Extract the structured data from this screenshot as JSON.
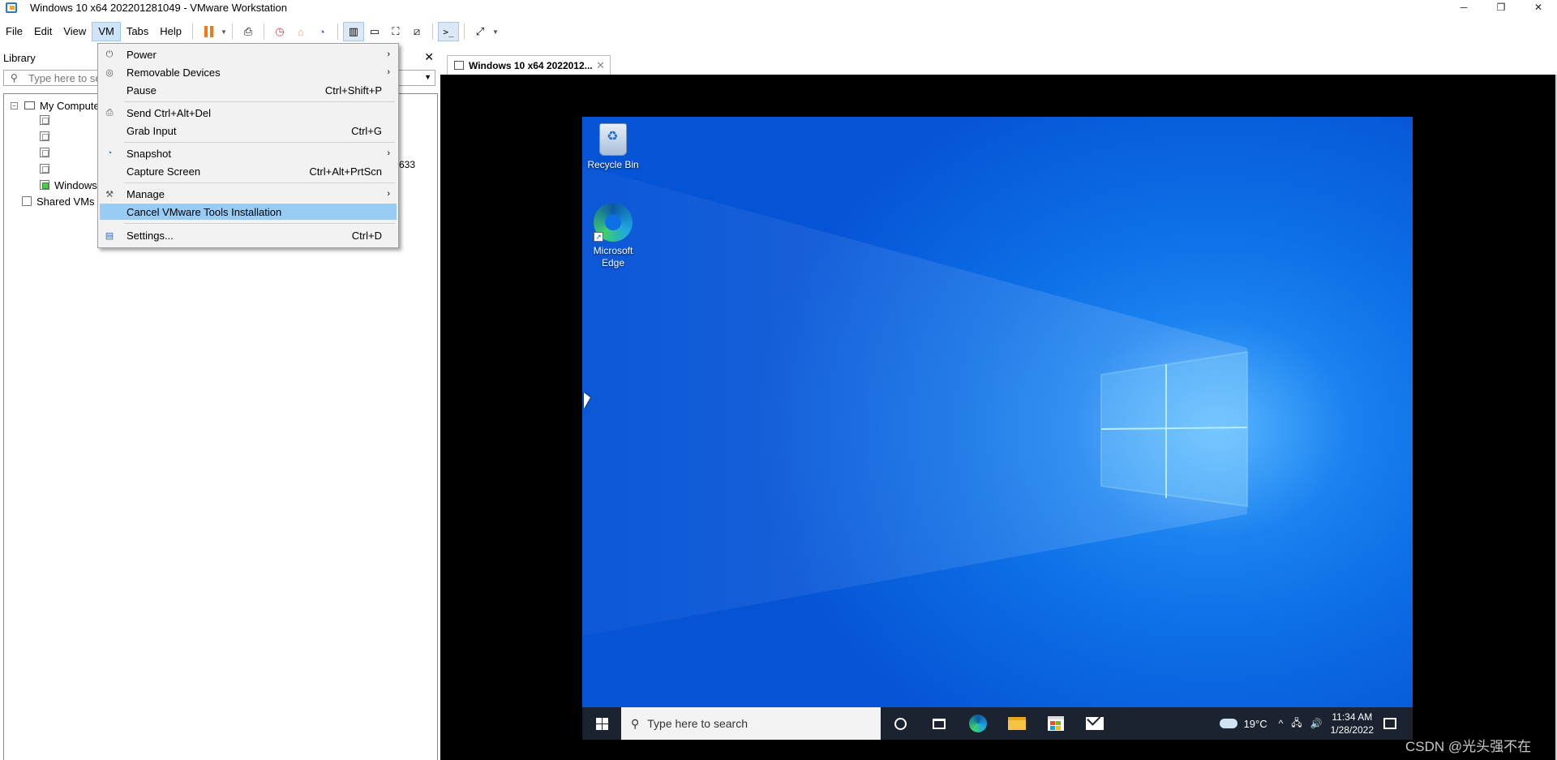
{
  "window": {
    "title": "Windows 10 x64 202201281049 - VMware Workstation",
    "minimize": "─",
    "restore": "❐",
    "close": "✕"
  },
  "menubar": {
    "items": [
      "File",
      "Edit",
      "View",
      "VM",
      "Tabs",
      "Help"
    ],
    "active": "VM"
  },
  "library": {
    "title": "Library",
    "close": "✕",
    "search_placeholder": "Type here to search",
    "tree": {
      "root_label": "My Computer",
      "root_toggle": "−",
      "running_vm_label": "Windows 10 x64 202201281049",
      "shared_label": "Shared VMs"
    },
    "stray_text": "633"
  },
  "vm_menu": {
    "items": [
      {
        "label": "Power",
        "shortcut": "",
        "submenu": true,
        "icon": "power-icon"
      },
      {
        "label": "Removable Devices",
        "shortcut": "",
        "submenu": true,
        "icon": "devices-icon"
      },
      {
        "label": "Pause",
        "shortcut": "Ctrl+Shift+P",
        "submenu": false,
        "icon": ""
      },
      {
        "label": "Send Ctrl+Alt+Del",
        "shortcut": "",
        "submenu": false,
        "icon": "keyboard-icon"
      },
      {
        "label": "Grab Input",
        "shortcut": "Ctrl+G",
        "submenu": false,
        "icon": ""
      },
      {
        "label": "Snapshot",
        "shortcut": "",
        "submenu": true,
        "icon": "snapshot-icon"
      },
      {
        "label": "Capture Screen",
        "shortcut": "Ctrl+Alt+PrtScn",
        "submenu": false,
        "icon": ""
      },
      {
        "label": "Manage",
        "shortcut": "",
        "submenu": true,
        "icon": "wrench-icon"
      },
      {
        "label": "Cancel VMware Tools Installation",
        "shortcut": "",
        "submenu": false,
        "icon": "",
        "highlighted": true
      },
      {
        "label": "Settings...",
        "shortcut": "Ctrl+D",
        "submenu": false,
        "icon": "settings-icon"
      }
    ]
  },
  "vm_tab": {
    "label": "Windows 10 x64 2022012...",
    "close": "✕"
  },
  "guest": {
    "desktop_icons": {
      "recycle_bin": "Recycle Bin",
      "edge": "Microsoft Edge"
    },
    "taskbar": {
      "search_placeholder": "Type here to search",
      "temperature": "19°C",
      "time": "11:34 AM",
      "date": "1/28/2022",
      "tray_chevron": "^",
      "network": "🖧",
      "volume": "🔊"
    }
  },
  "watermark": "CSDN @光头强不在",
  "colors": {
    "menu_highlight": "#99ccf5",
    "active_menu_bg": "#cfe5f7",
    "pause_orange": "#f07a1a",
    "desktop_blue": "#0d6fe6",
    "taskbar": "#1b2330"
  }
}
